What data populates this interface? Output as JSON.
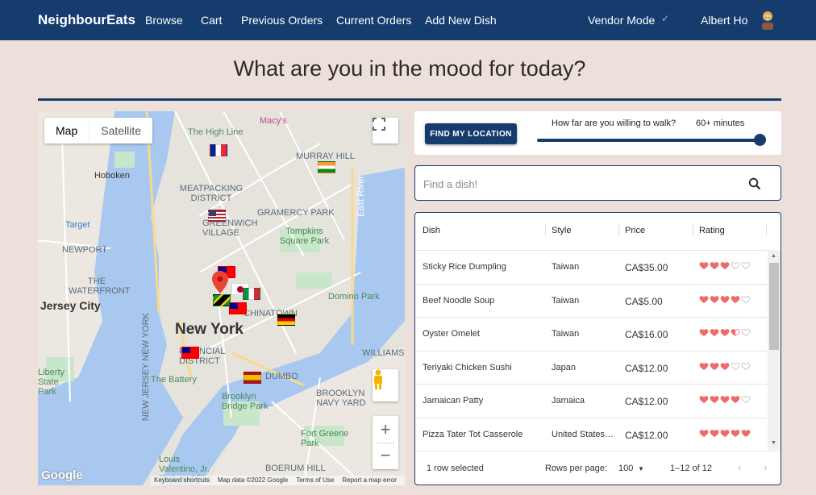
{
  "nav": {
    "brand": "NeighbourEats",
    "links": [
      "Browse",
      "Cart",
      "Previous Orders",
      "Current Orders",
      "Add New Dish"
    ],
    "vendor_mode": "Vendor Mode",
    "user_name": "Albert Ho"
  },
  "heading": "What are you in the mood for today?",
  "map": {
    "type_map": "Map",
    "type_satellite": "Satellite",
    "labels": [
      "The High Line",
      "Macy's",
      "MURRAY HILL",
      "Hoboken",
      "MEATPACKING DISTRICT",
      "GRAMERCY PARK",
      "GREENWICH VILLAGE",
      "Target",
      "Tompkins Square Park",
      "NEWPORT",
      "THE WATERFRONT",
      "Jersey City",
      "Domino Park",
      "New York",
      "CHINATOWN",
      "FINANCIAL DISTRICT",
      "WILLIAMS",
      "The Battery",
      "DUMBO",
      "Brooklyn Bridge Park",
      "BROOKLYN NAVY YARD",
      "Fort Greene Park",
      "BOERUM HILL",
      "Louis Valentino, Jr. Park and Pier",
      "NEW JERSEY NEW YORK",
      "Liberty State Park",
      "East River"
    ],
    "footer": [
      "Keyboard shortcuts",
      "Map data ©2022 Google",
      "Terms of Use",
      "Report a map error"
    ],
    "google": "Google"
  },
  "location": {
    "button": "FIND MY LOCATION",
    "walk_label": "How far are you willing to walk?",
    "walk_value": "60+ minutes",
    "walk_level": 1.0
  },
  "search": {
    "placeholder": "Find a dish!"
  },
  "table": {
    "headers": [
      "Dish",
      "Style",
      "Price",
      "Rating"
    ],
    "rows": [
      {
        "dish": "Sticky Rice Dumpling",
        "style": "Taiwan",
        "price": "CA$35.00",
        "rating": 3
      },
      {
        "dish": "Beef Noodle Soup",
        "style": "Taiwan",
        "price": "CA$5.00",
        "rating": 4
      },
      {
        "dish": "Oyster Omelet",
        "style": "Taiwan",
        "price": "CA$16.00",
        "rating": 3.5
      },
      {
        "dish": "Teriyaki Chicken Sushi",
        "style": "Japan",
        "price": "CA$12.00",
        "rating": 3
      },
      {
        "dish": "Jamaican Patty",
        "style": "Jamaica",
        "price": "CA$12.00",
        "rating": 4
      },
      {
        "dish": "Pizza Tater Tot Casserole",
        "style": "United States…",
        "price": "CA$12.00",
        "rating": 5
      }
    ],
    "selected": "1 row selected",
    "rows_per_page_label": "Rows per page:",
    "rows_per_page": "100",
    "range": "1–12 of 12"
  },
  "colors": {
    "primary": "#163c6e",
    "heart": "#f06a6a",
    "background": "#ede0da"
  }
}
